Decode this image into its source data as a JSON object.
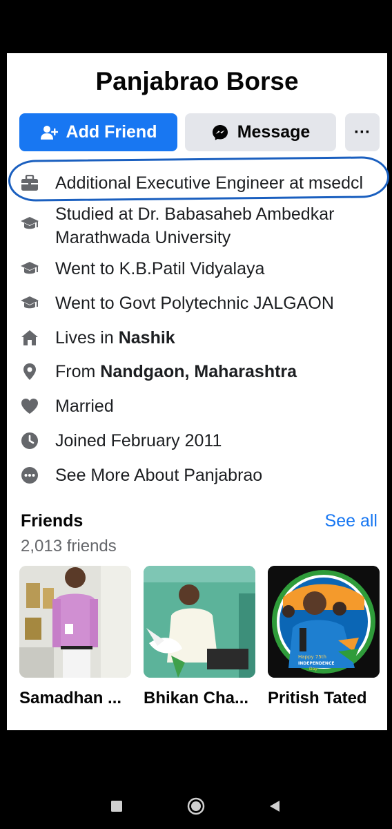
{
  "profile": {
    "name": "Panjabrao Borse",
    "add_friend_label": "Add Friend",
    "message_label": "Message",
    "more_label": "···"
  },
  "details": [
    {
      "icon": "briefcase-icon",
      "prefix": "Additional Executive Engineer at msedcl",
      "bold": ""
    },
    {
      "icon": "graduation-cap-icon",
      "prefix": "Studied at Dr. Babasaheb Ambedkar Marathwada University",
      "bold": ""
    },
    {
      "icon": "graduation-cap-icon",
      "prefix": "Went to K.B.Patil Vidyalaya",
      "bold": ""
    },
    {
      "icon": "graduation-cap-icon",
      "prefix": "Went to Govt Polytechnic JALGAON",
      "bold": ""
    },
    {
      "icon": "home-icon",
      "prefix": "Lives in ",
      "bold": "Nashik"
    },
    {
      "icon": "location-pin-icon",
      "prefix": "From ",
      "bold": "Nandgaon, Maharashtra"
    },
    {
      "icon": "heart-icon",
      "prefix": "Married",
      "bold": ""
    },
    {
      "icon": "clock-icon",
      "prefix": "Joined February 2011",
      "bold": ""
    },
    {
      "icon": "more-dots-icon",
      "prefix": "See More About Panjabrao",
      "bold": ""
    }
  ],
  "friends": {
    "title": "Friends",
    "count": "2,013 friends",
    "see_all": "See all",
    "items": [
      {
        "name": "Samadhan ..."
      },
      {
        "name": "Bhikan Cha..."
      },
      {
        "name": "Pritish Tated",
        "photo_text_1": "Happy 75th",
        "photo_text_2": "INDEPENDENCE",
        "photo_text_3": "Day"
      }
    ]
  },
  "colors": {
    "accent": "#1877f2",
    "secondary_button": "#e4e6eb",
    "highlight_ring": "#1a5fbf"
  }
}
